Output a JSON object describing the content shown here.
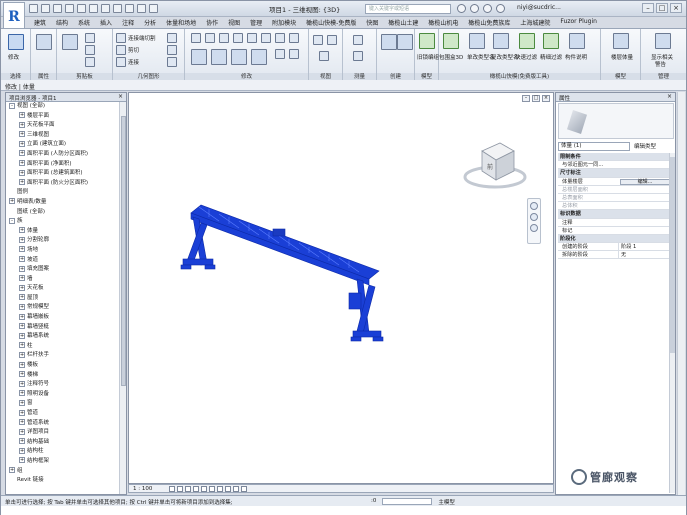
{
  "app": {
    "logo_letter": "R",
    "document_title": "项目1 - 三维视图: {3D}",
    "search_placeholder": "键入关键字或短语",
    "user": "niyi@sucdric..."
  },
  "ribbon_tabs": [
    "建筑",
    "结构",
    "系统",
    "插入",
    "注释",
    "分析",
    "体量和场地",
    "协作",
    "视图",
    "管理",
    "附加模块",
    "橄榄山快模-免费版",
    "快图",
    "橄榄山土建",
    "橄榄山机电",
    "橄榄山免费族库",
    "上海城建院",
    "Fuzor Plugin"
  ],
  "ribbon": {
    "modify_label": "修改",
    "panels": [
      "选择",
      "属性",
      "剪贴板",
      "几何图形",
      "修改",
      "视图",
      "测量",
      "创建",
      "模型",
      "橄榄山快模(免费版工具)",
      "模型",
      "管理"
    ],
    "geometry_items": [
      "连接端切割",
      "剪切",
      "连接"
    ],
    "tool_labels": [
      "旧锁编组",
      "包围盒3D",
      "单改类型名",
      "复改类型名",
      "快速过滤",
      "精细过滤",
      "构件说明",
      "楼层体量",
      "显示相关",
      "警告"
    ]
  },
  "options_bar": {
    "text": "修改 | 体量"
  },
  "project_browser": {
    "title": "项目浏览器 - 项目1",
    "items": [
      {
        "label": "视图 (全部)",
        "exp": "-",
        "indent": 0
      },
      {
        "label": "楼层平面",
        "exp": "+",
        "indent": 1
      },
      {
        "label": "天花板平面",
        "exp": "+",
        "indent": 1
      },
      {
        "label": "三维视图",
        "exp": "+",
        "indent": 1
      },
      {
        "label": "立面 (建筑立面)",
        "exp": "+",
        "indent": 1
      },
      {
        "label": "面积平面 (人防分区面积)",
        "exp": "+",
        "indent": 1
      },
      {
        "label": "面积平面 (净面积)",
        "exp": "+",
        "indent": 1
      },
      {
        "label": "面积平面 (总建筑面积)",
        "exp": "+",
        "indent": 1
      },
      {
        "label": "面积平面 (防火分区面积)",
        "exp": "+",
        "indent": 1
      },
      {
        "label": "图例",
        "exp": "",
        "indent": 0
      },
      {
        "label": "明细表/数量",
        "exp": "+",
        "indent": 0
      },
      {
        "label": "图纸 (全部)",
        "exp": "",
        "indent": 0
      },
      {
        "label": "族",
        "exp": "-",
        "indent": 0
      },
      {
        "label": "体量",
        "exp": "+",
        "indent": 1
      },
      {
        "label": "分割轮廓",
        "exp": "+",
        "indent": 1
      },
      {
        "label": "场地",
        "exp": "+",
        "indent": 1
      },
      {
        "label": "坡道",
        "exp": "+",
        "indent": 1
      },
      {
        "label": "填充图案",
        "exp": "+",
        "indent": 1
      },
      {
        "label": "墙",
        "exp": "+",
        "indent": 1
      },
      {
        "label": "天花板",
        "exp": "+",
        "indent": 1
      },
      {
        "label": "屋顶",
        "exp": "+",
        "indent": 1
      },
      {
        "label": "常规模型",
        "exp": "+",
        "indent": 1
      },
      {
        "label": "幕墙嵌板",
        "exp": "+",
        "indent": 1
      },
      {
        "label": "幕墙竖梃",
        "exp": "+",
        "indent": 1
      },
      {
        "label": "幕墙系统",
        "exp": "+",
        "indent": 1
      },
      {
        "label": "柱",
        "exp": "+",
        "indent": 1
      },
      {
        "label": "栏杆扶手",
        "exp": "+",
        "indent": 1
      },
      {
        "label": "楼板",
        "exp": "+",
        "indent": 1
      },
      {
        "label": "楼梯",
        "exp": "+",
        "indent": 1
      },
      {
        "label": "注释符号",
        "exp": "+",
        "indent": 1
      },
      {
        "label": "照明设备",
        "exp": "+",
        "indent": 1
      },
      {
        "label": "窗",
        "exp": "+",
        "indent": 1
      },
      {
        "label": "管道",
        "exp": "+",
        "indent": 1
      },
      {
        "label": "管道系统",
        "exp": "+",
        "indent": 1
      },
      {
        "label": "详图项目",
        "exp": "+",
        "indent": 1
      },
      {
        "label": "结构基础",
        "exp": "+",
        "indent": 1
      },
      {
        "label": "结构柱",
        "exp": "+",
        "indent": 1
      },
      {
        "label": "结构框架",
        "exp": "+",
        "indent": 1
      },
      {
        "label": "组",
        "exp": "+",
        "indent": 0
      },
      {
        "label": "Revit 链接",
        "exp": "",
        "indent": 0
      }
    ]
  },
  "view": {
    "scale": "1 : 100",
    "viewcube_face": "前"
  },
  "properties": {
    "title": "属性",
    "type_selector": "体量 (1)",
    "edit_type": "编辑类型",
    "rows": [
      {
        "type": "group",
        "label": "限制条件"
      },
      {
        "type": "row",
        "label": "与邻近图元一同...",
        "value": "",
        "grey": false
      },
      {
        "type": "group",
        "label": "尺寸标注"
      },
      {
        "type": "button",
        "label": "体量楼层",
        "value": "编辑..."
      },
      {
        "type": "row",
        "label": "总楼层面积",
        "value": "",
        "grey": true
      },
      {
        "type": "row",
        "label": "总表面积",
        "value": "",
        "grey": true
      },
      {
        "type": "row",
        "label": "总体积",
        "value": "",
        "grey": true
      },
      {
        "type": "group",
        "label": "标识数据"
      },
      {
        "type": "row",
        "label": "注释",
        "value": "",
        "grey": false
      },
      {
        "type": "row",
        "label": "标记",
        "value": "",
        "grey": false
      },
      {
        "type": "group",
        "label": "阶段化"
      },
      {
        "type": "row",
        "label": "创建的阶段",
        "value": "阶段 1",
        "grey": false
      },
      {
        "type": "row",
        "label": "拆除的阶段",
        "value": "无",
        "grey": false
      }
    ]
  },
  "statusbar": {
    "text": "单击可进行选择; 按 Tab 键并单击可选择其他项目; 按 Ctrl 键并单击可将新项目添加到选择集;",
    "coord": ":0",
    "model": "主模型"
  },
  "watermark": {
    "text": "管廊观察"
  },
  "colors": {
    "model_blue": "#1a3fd6",
    "panel_bg": "#dde3ec"
  }
}
